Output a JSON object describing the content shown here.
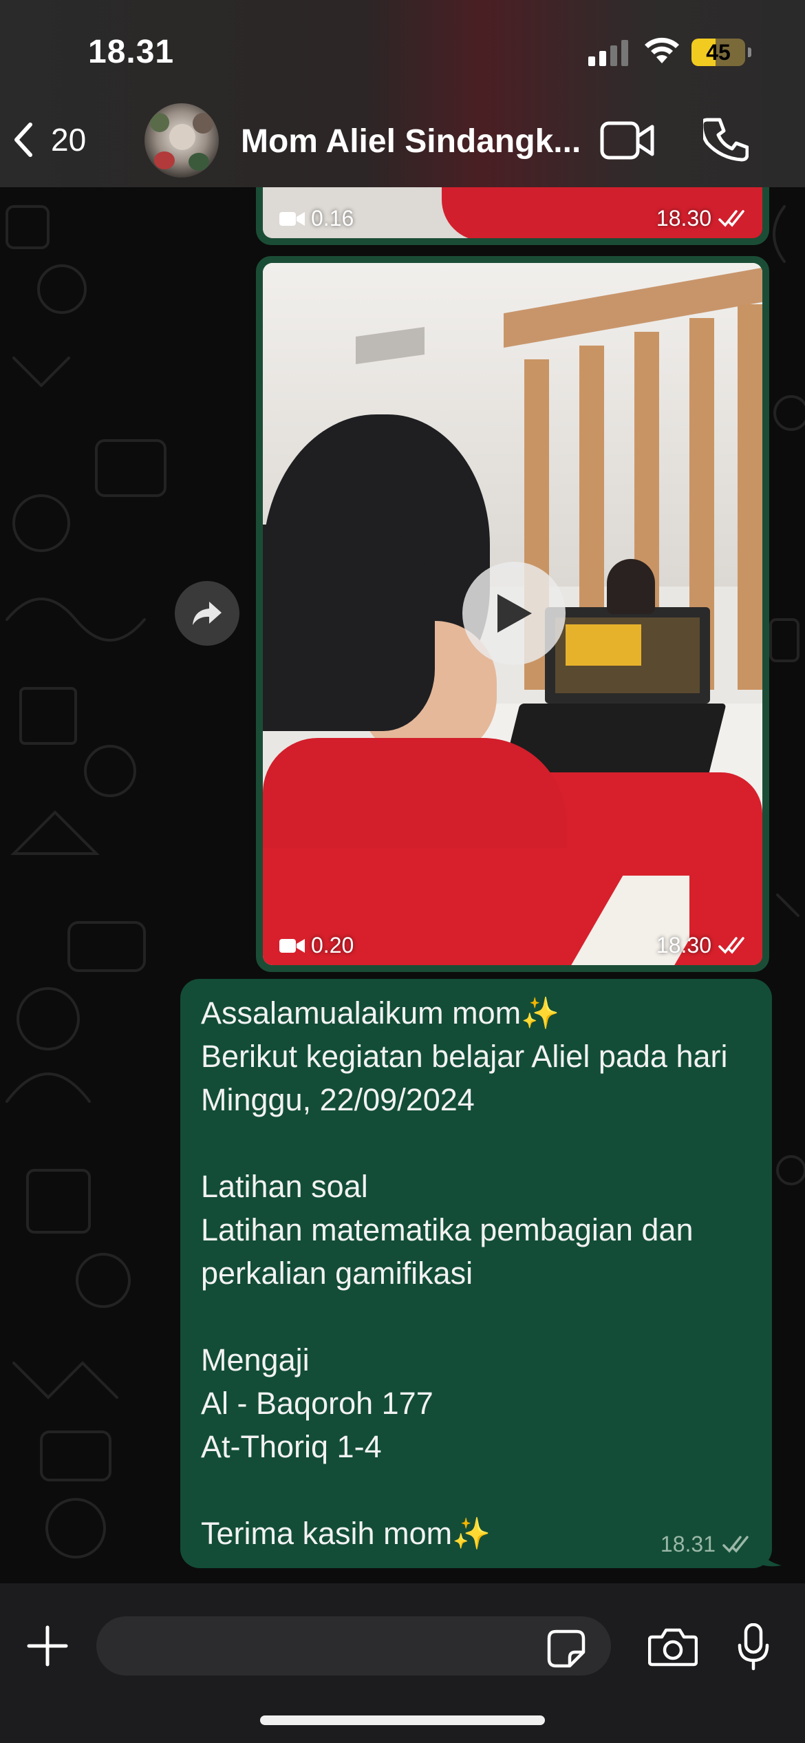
{
  "status_bar": {
    "time": "18.31",
    "battery": "45"
  },
  "header": {
    "back_count": "20",
    "contact_name": "Mom Aliel Sindangk..."
  },
  "messages": {
    "video1": {
      "duration": "0.16",
      "time": "18.30"
    },
    "video2": {
      "duration": "0.20",
      "time": "18.30"
    },
    "text": {
      "body": "Assalamualaikum mom✨\nBerikut kegiatan belajar Aliel pada hari Minggu, 22/09/2024\n\nLatihan soal\nLatihan matematika pembagian dan perkalian gamifikasi\n\nMengaji\nAl - Baqoroh 177\nAt-Thoriq 1-4\n\nTerima kasih mom✨",
      "time": "18.31"
    }
  },
  "input_bar": {
    "placeholder": ""
  },
  "colors": {
    "bubble_outgoing": "#134d37",
    "battery_yellow": "#f2cb21",
    "chat_background": "#0c0c0c"
  },
  "icons": [
    "back-chevron-icon",
    "video-call-icon",
    "phone-icon",
    "forward-icon",
    "play-icon",
    "video-camera-icon",
    "double-check-icon",
    "plus-icon",
    "sticker-icon",
    "camera-icon",
    "microphone-icon"
  ]
}
